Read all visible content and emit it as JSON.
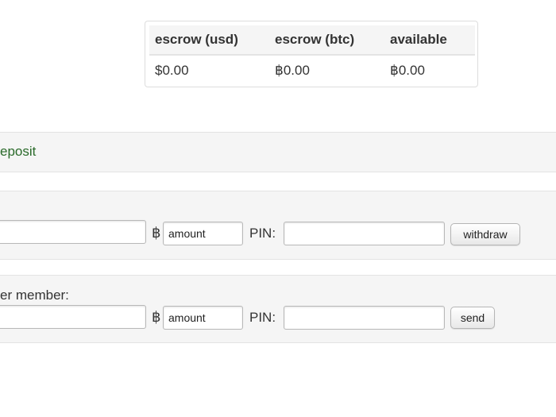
{
  "balances": {
    "headers": [
      "escrow (usd)",
      "escrow (btc)",
      "available"
    ],
    "values": [
      "$0.00",
      "฿0.00",
      "฿0.00"
    ]
  },
  "deposit": {
    "link_label": "eposit"
  },
  "withdraw": {
    "address_value": "",
    "currency_symbol": "฿",
    "amount_placeholder": "amount",
    "pin_label": "PIN:",
    "pin_value": "",
    "button_label": "withdraw"
  },
  "send": {
    "title": "er member:",
    "recipient_value": "",
    "currency_symbol": "฿",
    "amount_placeholder": "amount",
    "pin_label": "PIN:",
    "pin_value": "",
    "button_label": "send"
  }
}
